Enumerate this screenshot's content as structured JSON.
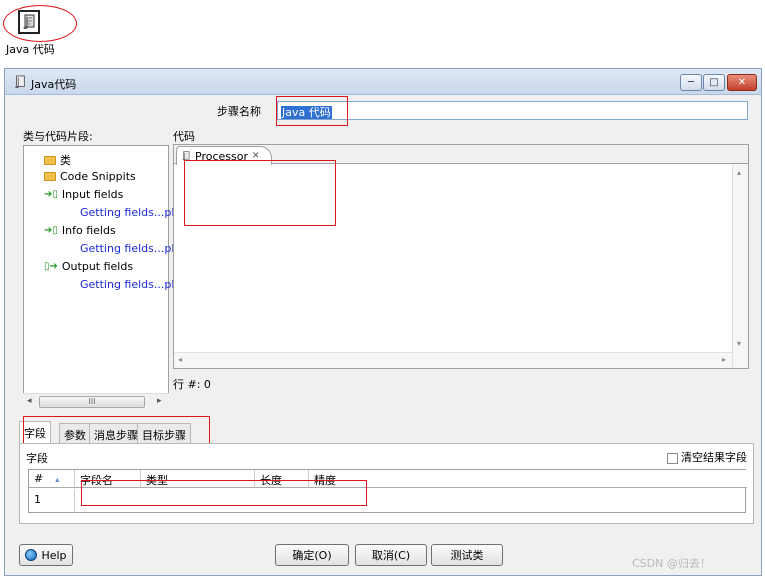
{
  "step_icon": {
    "label": "Java 代码"
  },
  "window": {
    "title": "Java代码",
    "min_label": "─",
    "max_label": "□",
    "close_label": "✕"
  },
  "step_name": {
    "label": "步骤名称",
    "value": "Java 代码"
  },
  "left_panel": {
    "label": "类与代码片段:",
    "items": [
      {
        "label": "类"
      },
      {
        "label": "Code Snippits"
      },
      {
        "label": "Input fields"
      },
      {
        "label": "Getting fields...pl"
      },
      {
        "label": "Info fields"
      },
      {
        "label": "Getting fields...pl"
      },
      {
        "label": "Output fields"
      },
      {
        "label": "Getting fields...pl"
      }
    ],
    "scroll_thumb": "III"
  },
  "code": {
    "label": "代码",
    "tab_label": "Processor",
    "tab_close": "✕",
    "line_label": "行 #: 0"
  },
  "tabs": [
    {
      "label": "字段"
    },
    {
      "label": "参数"
    },
    {
      "label": "消息步骤"
    },
    {
      "label": "目标步骤"
    }
  ],
  "fields_panel": {
    "label": "字段",
    "clear_label": "清空结果字段",
    "columns": [
      "#",
      "字段名",
      "类型",
      "长度",
      "精度"
    ],
    "rows": [
      {
        "num": "1"
      }
    ]
  },
  "buttons": {
    "help": "Help",
    "ok": "确定(O)",
    "cancel": "取消(C)",
    "test": "测试类"
  },
  "watermark": "CSDN @归去！"
}
